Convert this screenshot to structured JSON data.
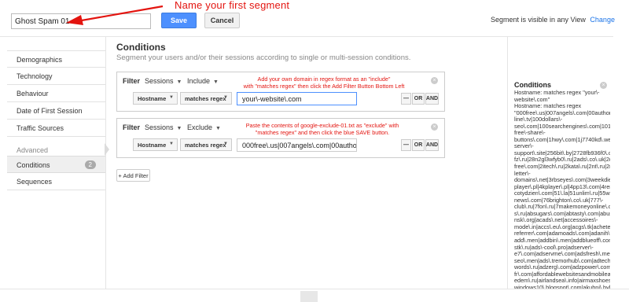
{
  "header": {
    "segment_name": "Ghost Spam 01",
    "save_label": "Save",
    "cancel_label": "Cancel",
    "visibility_text": "Segment is visible in any View",
    "change_label": "Change",
    "annotation": "Name your first segment"
  },
  "sidebar": {
    "items": [
      {
        "label": "Demographics"
      },
      {
        "label": "Technology"
      },
      {
        "label": "Behaviour"
      },
      {
        "label": "Date of First Session"
      },
      {
        "label": "Traffic Sources"
      }
    ],
    "advanced_label": "Advanced",
    "advanced_items": [
      {
        "label": "Conditions",
        "count": "2",
        "active": true
      },
      {
        "label": "Sequences"
      }
    ]
  },
  "main": {
    "title": "Conditions",
    "subtitle": "Segment your users and/or their sessions according to single or multi-session conditions.",
    "filters": [
      {
        "filter_label": "Filter",
        "scope": "Sessions",
        "mode": "Include",
        "dimension": "Hostname",
        "operator": "matches regex",
        "value": "your\\-website\\.com",
        "and_label": "AND",
        "or_label": "OR",
        "minus_label": "—",
        "annotation_lines": [
          "Add your own domain in regex format as an \"include\"",
          "with \"matches regex\" then click the Add Filter Button Bottom Left"
        ]
      },
      {
        "filter_label": "Filter",
        "scope": "Sessions",
        "mode": "Exclude",
        "dimension": "Hostname",
        "operator": "matches regex",
        "value": "000free\\.us|007angels\\.com|00author\\.",
        "and_label": "AND",
        "or_label": "OR",
        "minus_label": "—",
        "annotation_lines": [
          "Paste the contents of google-exclude-01.txt as \"exclude\" with",
          "\"matches regex\" and then click the blue SAVE button."
        ]
      }
    ],
    "add_filter_label": "+ Add Filter"
  },
  "summary": {
    "title": "Conditions",
    "lines": [
      "Hostname: matches regex \"your\\-",
      "website\\.com\"",
      "Hostname: matches regex",
      "\"000free\\.us|007angels\\.com|00author\\.o",
      "line\\.tv|100dollars\\-",
      "seo\\.com|100searchengines\\.com|101bil",
      "free\\-share\\-",
      "buttons\\.com|1hwy\\.com|1j7740kd\\.web",
      "server\\-",
      "support\\.site|256bit\\.by|2728fb936f0\\.c",
      "fz\\.ru|28n2gl3wfyb0\\.ru|2ads\\.co\\.uk|2dr",
      "free\\.com|2itech\\.ru|2kata\\.ru|2nt\\.ru|2ric",
      "letter\\-",
      "domains\\.net|3rbseyes\\.com|3weekdiet\\",
      "player\\.pl|4kplayer\\.pl|4pp13\\.com|4rent\\",
      "cotydzien\\.com|51\\.la|51unlim\\.ru|55wm",
      "news\\.com|76brighton\\.co\\.uk|777\\-",
      "club\\.ru|7fon\\.ru|7makemoneyonline\\.co",
      "s\\.ru|absugars\\.com|abtasty\\.com|abuso",
      "nsk\\.org|acads\\.net|accessoires\\-",
      "mode\\.in|accs\\.eu\\.org|acgs\\.tk|acheterviag",
      "referrer\\.com|adamoads\\.com|adanih\\.c",
      "add\\.men|addbin\\.men|addblueoff\\.com",
      "stk\\.ru|ads\\-cool\\.pro|adserver\\-",
      "e7\\.com|adservme\\.com|adsfresh\\.men|a",
      "seo\\.men|ads\\.tremorhub\\.com|adtech\\.",
      "words\\.ru|adzerg\\.com|adzpower\\.com|a",
      "fr\\.com|affordablewebsitesandmobileapp",
      "edem\\.ru|airlandsea\\.info|airmaxshoes\\.",
      "windows10\\.blogspot\\.com|akuhni\\.by|al",
      "fdm\\.xyz|alert\\-fjg\\.xyz|alert\\-"
    ]
  }
}
